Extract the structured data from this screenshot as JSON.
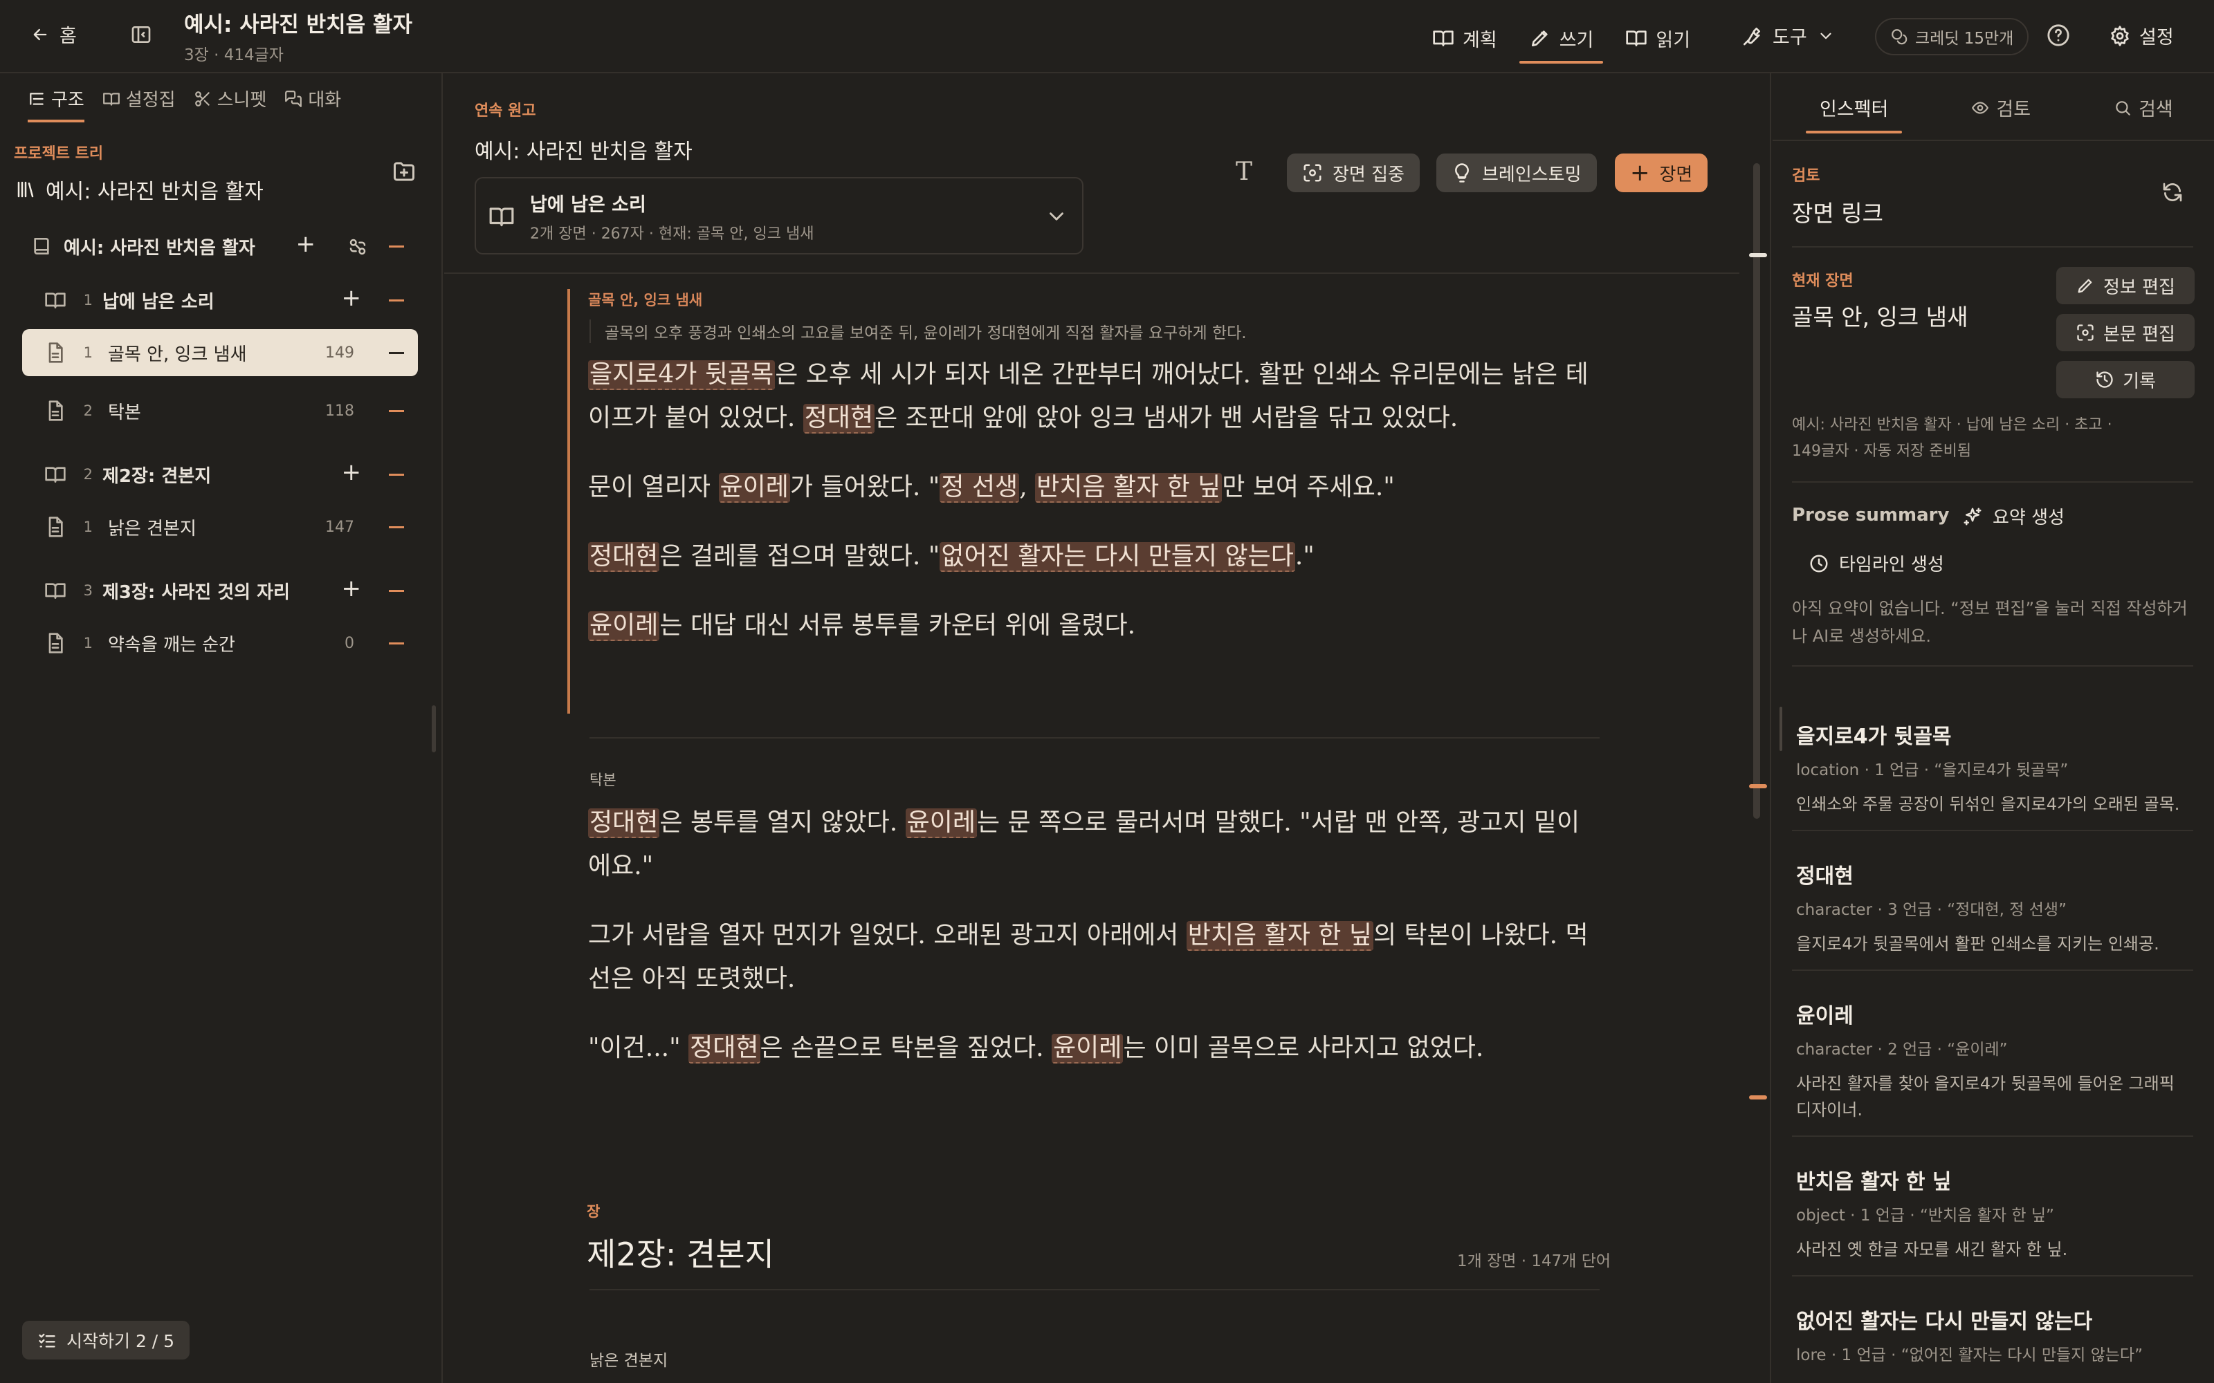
{
  "topbar": {
    "home_label": "홈",
    "project_title": "예시: 사라진 반치음 활자",
    "project_sub": "3장 · 414글자",
    "modes": [
      {
        "label": "계획",
        "icon": "book-open-icon"
      },
      {
        "label": "쓰기",
        "icon": "pen-icon"
      },
      {
        "label": "읽기",
        "icon": "book-open-icon"
      }
    ],
    "tools_label": "도구",
    "credit_label": "크레딧 15만개",
    "settings_label": "설정"
  },
  "left": {
    "tabs": [
      "구조",
      "설정집",
      "스니펫",
      "대화"
    ],
    "tree_label": "프로젝트 트리",
    "tree_root": "예시: 사라진 반치음 활자",
    "book": "예시: 사라진 반치음 활자",
    "chapters": [
      {
        "num": "1",
        "title": "납에 남은 소리",
        "scenes": [
          {
            "num": "1",
            "title": "골목 안, 잉크 냄새",
            "count": "149"
          },
          {
            "num": "2",
            "title": "탁본",
            "count": "118"
          }
        ]
      },
      {
        "num": "2",
        "title": "제2장: 견본지",
        "scenes": [
          {
            "num": "1",
            "title": "낡은 견본지",
            "count": "147"
          }
        ]
      },
      {
        "num": "3",
        "title": "제3장: 사라진 것의 자리",
        "scenes": [
          {
            "num": "1",
            "title": "약속을 깨는 순간",
            "count": "0"
          }
        ]
      }
    ],
    "start_label": "시작하기 2 / 5"
  },
  "center": {
    "header": "연속 원고",
    "title": "예시: 사라진 반치음 활자",
    "chapter_select": {
      "name": "납에 남은 소리",
      "meta": "2개 장면 · 267자 · 현재: 골목 안, 잉크 냄새"
    },
    "buttons": {
      "focus": "장면 집중",
      "brainstorm": "브레인스토밍",
      "scene": "장면"
    },
    "scene1": {
      "heading": "골목 안, 잉크 냄새",
      "summary": "골목의 오후 풍경과 인쇄소의 고요를 보여준 뒤, 윤이레가 정대현에게 직접 활자를 요구하게 한다.",
      "p1a": "을지로4가 뒷골목",
      "p1b": "은 오후 세 시가 되자 네온 간판부터 깨어났다. 활판 인쇄소 유리문에는 낡은 테이프가 붙어 있었다. ",
      "p1c": "정대현",
      "p1d": "은 조판대 앞에 앉아 잉크 냄새가 밴 서랍을 닦고 있었다.",
      "p2a": "문이 열리자 ",
      "p2b": "윤이레",
      "p2c": "가 들어왔다. \"",
      "p2d": "정 선생",
      "p2e": ", ",
      "p2f": "반치음 활자 한 닢",
      "p2g": "만 보여 주세요.\"",
      "p3a": "정대현",
      "p3b": "은 걸레를 접으며 말했다. \"",
      "p3c": "없어진 활자는 다시 만들지 않는다",
      "p3d": ".\"",
      "p4a": "윤이레",
      "p4b": "는 대답 대신 서류 봉투를 카운터 위에 올렸다."
    },
    "scene2": {
      "heading": "탁본",
      "p1a": "정대현",
      "p1b": "은 봉투를 열지 않았다. ",
      "p1c": "윤이레",
      "p1d": "는 문 쪽으로 물러서며 말했다. \"서랍 맨 안쪽, 광고지 밑이에요.\"",
      "p2a": "그가 서랍을 열자 먼지가 일었다. 오래된 광고지 아래에서 ",
      "p2b": "반치음 활자 한 닢",
      "p2c": "의 탁본이 나왔다. 먹선은 아직 또렷했다.",
      "p3a": "\"이건...\" ",
      "p3b": "정대현",
      "p3c": "은 손끝으로 탁본을 짚었다. ",
      "p3d": "윤이레",
      "p3e": "는 이미 골목으로 사라지고 없었다."
    },
    "chapter2": {
      "label": "장",
      "title": "제2장: 견본지",
      "meta": "1개 장면 · 147개 단어",
      "scene": "낡은 견본지"
    }
  },
  "right": {
    "tabs": [
      "인스펙터",
      "검토",
      "검색"
    ],
    "review_label": "검토",
    "review_title": "장면 링크",
    "current_label": "현재 장면",
    "current_title": "골목 안, 잉크 냄새",
    "btn_info": "정보 편집",
    "btn_body": "본문 편집",
    "btn_history": "기록",
    "meta_line1": "예시: 사라진 반치음 활자 · 납에 남은 소리 · 초고 ·",
    "meta_line2": "149글자 · 자동 저장 준비됨",
    "prose_summary": "Prose summary",
    "gen_summary": "요약 생성",
    "gen_timeline": "타임라인 생성",
    "empty_line1": "아직 요약이 없습니다. “정보 편집”을 눌러 직접 작성하거",
    "empty_line2": "나 AI로 생성하세요.",
    "entities": [
      {
        "name": "을지로4가 뒷골목",
        "meta": "location · 1 언급 · “을지로4가 뒷골목”",
        "desc": "인쇄소와 주물 공장이 뒤섞인 을지로4가의 오래된 골목.",
        "desc2": ""
      },
      {
        "name": "정대현",
        "meta": "character · 3 언급 · “정대현, 정 선생”",
        "desc": "을지로4가 뒷골목에서 활판 인쇄소를 지키는 인쇄공.",
        "desc2": ""
      },
      {
        "name": "윤이레",
        "meta": "character · 2 언급 · “윤이레”",
        "desc": "사라진 활자를 찾아 을지로4가 뒷골목에 들어온 그래픽",
        "desc2": "디자이너."
      },
      {
        "name": "반치음 활자 한 닢",
        "meta": "object · 1 언급 · “반치음 활자 한 닢”",
        "desc": "사라진 옛 한글 자모를 새긴 활자 한 닢.",
        "desc2": ""
      },
      {
        "name": "없어진 활자는 다시 만들지 않는다",
        "meta": "lore · 1 언급 · “없어진 활자는 다시 만들지 않는다”",
        "desc": "",
        "desc2": ""
      }
    ]
  },
  "colors": {
    "accent": "#e08d5b",
    "background": "#22201d",
    "highlight": "#5a3d31",
    "selected": "#ece2d3"
  }
}
